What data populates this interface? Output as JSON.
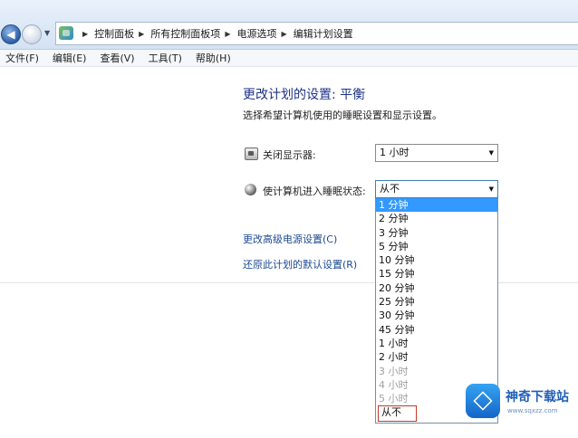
{
  "address_bar": {
    "breadcrumbs": [
      "控制面板",
      "所有控制面板项",
      "电源选项",
      "编辑计划设置"
    ]
  },
  "menu": [
    "文件(F)",
    "编辑(E)",
    "查看(V)",
    "工具(T)",
    "帮助(H)"
  ],
  "plan": {
    "title": "更改计划的设置: 平衡",
    "description": "选择希望计算机使用的睡眠设置和显示设置。"
  },
  "settings": {
    "display_off": {
      "label": "关闭显示器:",
      "value": "1 小时"
    },
    "sleep": {
      "label": "使计算机进入睡眠状态:",
      "value": "从不"
    }
  },
  "links": {
    "advanced": "更改高级电源设置(C)",
    "restore": "还原此计划的默认设置(R)"
  },
  "sleep_options": [
    "1 分钟",
    "2 分钟",
    "3 分钟",
    "5 分钟",
    "10 分钟",
    "15 分钟",
    "20 分钟",
    "25 分钟",
    "30 分钟",
    "45 分钟",
    "1 小时",
    "2 小时",
    "3 小时",
    "4 小时",
    "5 小时",
    "从不"
  ],
  "watermark": {
    "title": "神奇下载站",
    "url": "www.sqxzz.com"
  },
  "colors": {
    "accent": "#3399ff",
    "link": "#1c4a93",
    "title": "#1e3287"
  }
}
